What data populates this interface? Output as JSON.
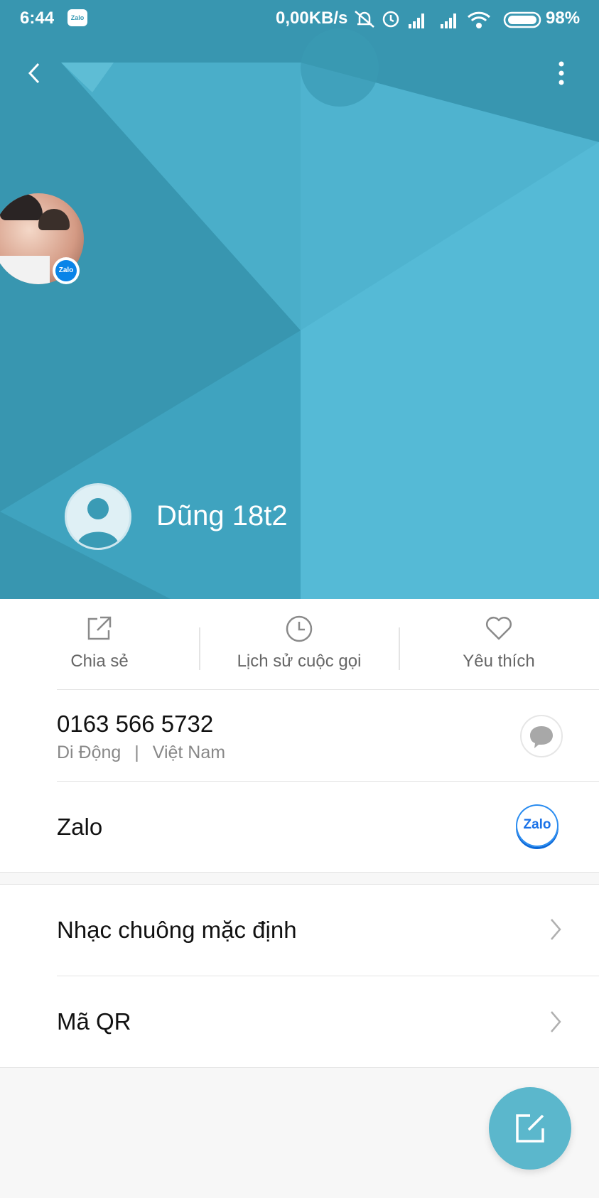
{
  "status_bar": {
    "time": "6:44",
    "notification_app": "Zalo",
    "network_speed": "0,00KB/s",
    "battery": "98%",
    "icons": [
      "muted-bell-icon",
      "alarm-icon",
      "signal-icon",
      "signal-icon",
      "wifi-icon",
      "battery-icon"
    ]
  },
  "header": {
    "back_icon": "chevron-left-icon",
    "menu_icon": "more-vertical-icon",
    "zalo_badge": "Zalo",
    "contact_name": "Dũng 18t2",
    "background_color": "#3a9bb5"
  },
  "actions": [
    {
      "label": "Chia sẻ",
      "icon": "share-icon"
    },
    {
      "label": "Lịch sử cuộc gọi",
      "icon": "clock-icon"
    },
    {
      "label": "Yêu thích",
      "icon": "heart-icon"
    }
  ],
  "phone": {
    "number": "0163 566 5732",
    "type": "Di Động",
    "separator": "|",
    "region": "Việt Nam",
    "message_icon": "message-bubble-icon"
  },
  "zalo": {
    "label": "Zalo",
    "app_icon_text": "Zalo"
  },
  "settings": [
    {
      "label": "Nhạc chuông mặc định"
    },
    {
      "label": "Mã QR"
    }
  ],
  "fab": {
    "icon": "edit-icon",
    "color": "#5bb7cc"
  }
}
